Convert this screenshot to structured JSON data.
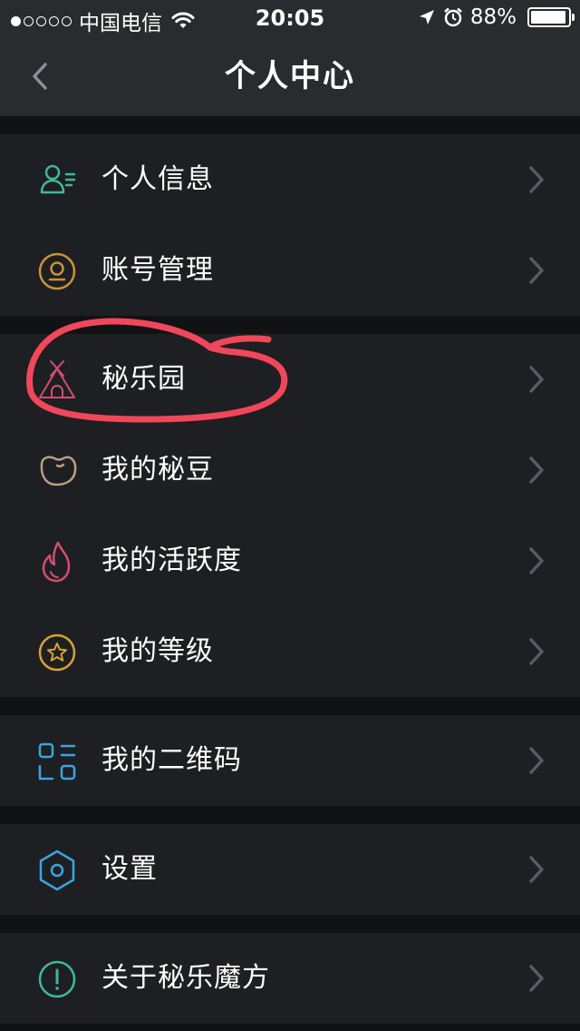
{
  "status_bar": {
    "carrier": "中国电信",
    "time": "20:05",
    "battery": "88%",
    "battery_level": 0.88,
    "signal_icon": "signal-dots-icon",
    "wifi_icon": "wifi-icon",
    "location_icon": "location-arrow-icon",
    "alarm_icon": "alarm-icon"
  },
  "nav": {
    "title": "个人中心",
    "back_icon": "chevron-left-icon"
  },
  "colors": {
    "background": "#111213",
    "bar": "#2a2b2e",
    "row": "#1e1f22",
    "chevron": "#5a5b60",
    "annotation": "#f0475a"
  },
  "menu": {
    "personal_info": {
      "label": "个人信息",
      "icon": "user-profile-icon",
      "color": "#3fb89a"
    },
    "account_manage": {
      "label": "账号管理",
      "icon": "coin-icon",
      "color": "#c9913a"
    },
    "mile_garden": {
      "label": "秘乐园",
      "icon": "tent-icon",
      "color": "#d14f6e"
    },
    "my_beans": {
      "label": "我的秘豆",
      "icon": "bean-icon",
      "color": "#b99f82"
    },
    "my_activity": {
      "label": "我的活跃度",
      "icon": "flame-icon",
      "color": "#d14f6e"
    },
    "my_level": {
      "label": "我的等级",
      "icon": "star-badge-icon",
      "color": "#d8a236"
    },
    "my_qrcode": {
      "label": "我的二维码",
      "icon": "qrcode-icon",
      "color": "#3aa5e0"
    },
    "settings": {
      "label": "设置",
      "icon": "hexagon-settings-icon",
      "color": "#3aa5e0"
    },
    "about": {
      "label": "关于秘乐魔方",
      "icon": "info-exclamation-icon",
      "color": "#3fb89a"
    }
  },
  "row_chevron_icon": "chevron-right-icon"
}
